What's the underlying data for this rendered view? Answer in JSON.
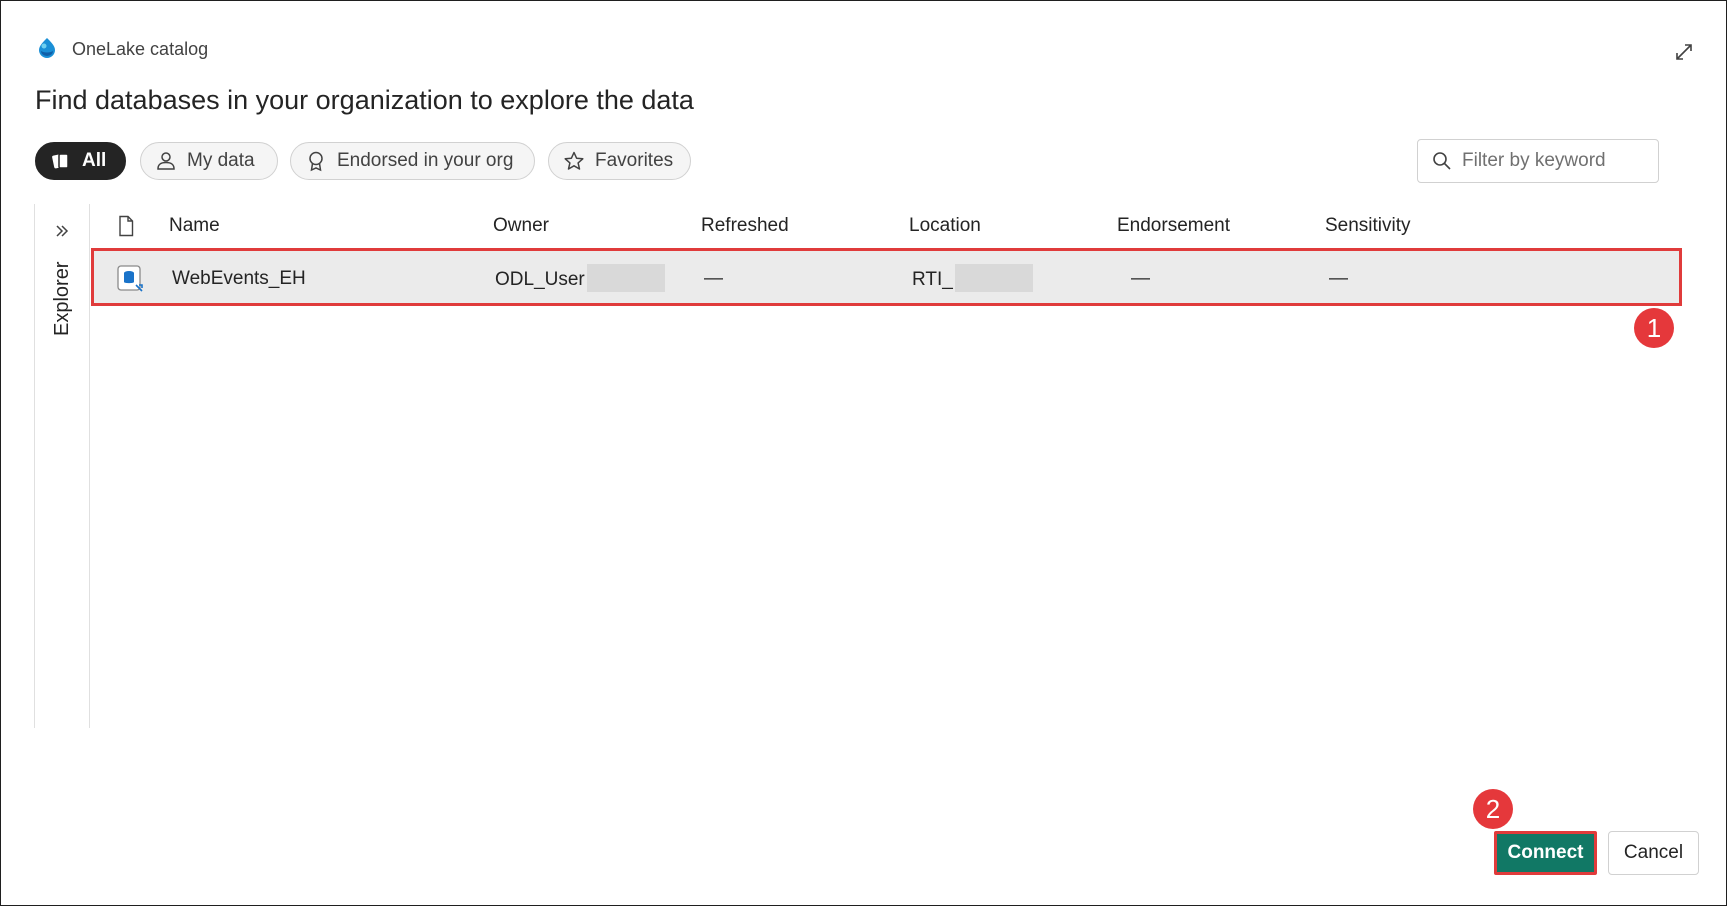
{
  "header": {
    "app_title": "OneLake catalog",
    "page_title": "Find databases in your organization to explore the data"
  },
  "filters": {
    "pills": [
      {
        "label": "All",
        "active": true
      },
      {
        "label": "My data",
        "active": false
      },
      {
        "label": "Endorsed in your org",
        "active": false
      },
      {
        "label": "Favorites",
        "active": false
      }
    ],
    "search_placeholder": "Filter by keyword"
  },
  "explorer": {
    "label": "Explorer"
  },
  "table": {
    "columns": [
      "Name",
      "Owner",
      "Refreshed",
      "Location",
      "Endorsement",
      "Sensitivity"
    ],
    "rows": [
      {
        "name": "WebEvents_EH",
        "owner": "ODL_User",
        "refreshed": "—",
        "location": "RTI_",
        "endorsement": "—",
        "sensitivity": "—",
        "selected": true,
        "icon": "kql-database-icon"
      }
    ]
  },
  "annotations": {
    "step1": "1",
    "step2": "2"
  },
  "footer": {
    "connect_label": "Connect",
    "cancel_label": "Cancel"
  },
  "colors": {
    "accent": "#117865",
    "highlight": "#e03b3b",
    "active_pill": "#242424"
  }
}
